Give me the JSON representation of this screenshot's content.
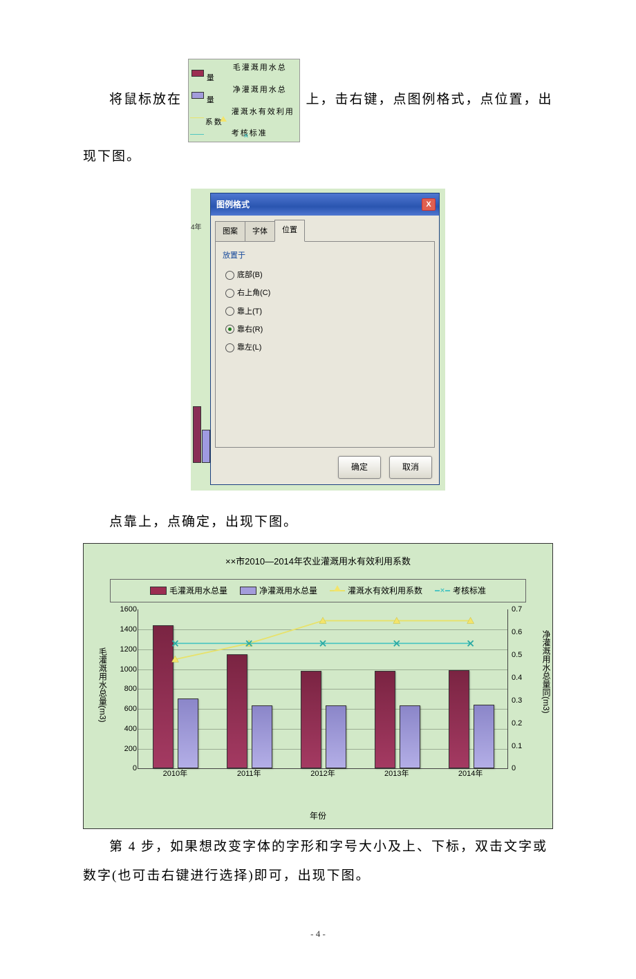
{
  "text": {
    "para1_a": "将鼠标放在",
    "para1_b": "上，击右键，点图例格式，点位置，出现下图。",
    "para2": "点靠上，点确定，出现下图。",
    "para3": "第 4 步，如果想改变字体的字形和字号大小及上、下标，双击文字或数字(也可击右键进行选择)即可，出现下图。",
    "page_num": "- 4 -"
  },
  "inline_legend": {
    "items": [
      "毛灌溉用水总量",
      "净灌溉用水总量",
      "灌溉水有效利用系数",
      "考核标准"
    ]
  },
  "dialog": {
    "title": "图例格式",
    "close": "X",
    "tabs": [
      "图案",
      "字体",
      "位置"
    ],
    "active_tab": "位置",
    "group_label": "放置于",
    "options": [
      {
        "label": "底部(B)",
        "selected": false
      },
      {
        "label": "右上角(C)",
        "selected": false
      },
      {
        "label": "靠上(T)",
        "selected": false
      },
      {
        "label": "靠右(R)",
        "selected": true
      },
      {
        "label": "靠左(L)",
        "selected": false
      }
    ],
    "behind_year": "4年",
    "ok": "确定",
    "cancel": "取消"
  },
  "chart_data": {
    "type": "bar+line",
    "title": "××市2010—2014年农业灌溉用水有效利用系数",
    "categories": [
      "2010年",
      "2011年",
      "2012年",
      "2013年",
      "2014年"
    ],
    "xlabel": "年份",
    "left_axis": {
      "label": "毛灌溉用水总量(m3)",
      "min": 0,
      "max": 1600,
      "step": 200
    },
    "right_axis": {
      "label": "净灌溉用水总量同(m3)",
      "min": 0,
      "max": 0.7,
      "step": 0.1
    },
    "series": [
      {
        "name": "毛灌溉用水总量",
        "type": "bar",
        "axis": "left",
        "color": "#9c2d52",
        "values": [
          1430,
          1140,
          970,
          970,
          975
        ]
      },
      {
        "name": "净灌溉用水总量",
        "type": "bar",
        "axis": "left",
        "color": "#a39cdb",
        "values": [
          690,
          625,
          625,
          625,
          630
        ]
      },
      {
        "name": "灌溉水有效利用系数",
        "type": "line",
        "axis": "right",
        "color": "#e8e26a",
        "marker": "triangle",
        "values": [
          0.48,
          0.55,
          0.65,
          0.65,
          0.65
        ]
      },
      {
        "name": "考核标准",
        "type": "line",
        "axis": "right",
        "color": "#4fc6c1",
        "marker": "x",
        "values": [
          0.55,
          0.55,
          0.55,
          0.55,
          0.55
        ]
      }
    ],
    "legend_position": "top"
  }
}
